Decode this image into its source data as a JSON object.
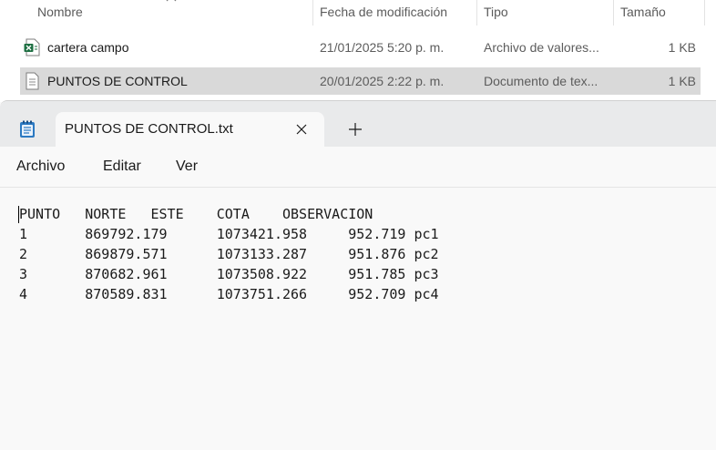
{
  "explorer": {
    "columns": {
      "name": "Nombre",
      "date": "Fecha de modificación",
      "type": "Tipo",
      "size": "Tamaño"
    },
    "files": [
      {
        "name": "cartera campo",
        "date": "21/01/2025 5:20 p. m.",
        "type": "Archivo de valores...",
        "size": "1 KB",
        "icon": "excel-csv-icon"
      },
      {
        "name": "PUNTOS DE CONTROL",
        "date": "20/01/2025 2:22 p. m.",
        "type": "Documento de tex...",
        "size": "1 KB",
        "icon": "text-document-icon",
        "selected": true
      }
    ]
  },
  "notepad": {
    "tab_title": "PUNTOS DE CONTROL.txt",
    "menu": {
      "file": "Archivo",
      "edit": "Editar",
      "view": "Ver"
    },
    "content": "PUNTO\tNORTE\tESTE\tCOTA\tOBSERVACION\n1\t869792.179\t1073421.958\t952.719 pc1\n2\t869879.571\t1073133.287\t951.876 pc2\n3\t870682.961\t1073508.922\t951.785 pc3\n4\t870589.831\t1073751.266\t952.709 pc4"
  },
  "colors": {
    "selection": "#d9d9d9",
    "tabstrip": "#e9eaeb",
    "editor_bg": "#f9f9f9",
    "excel_green": "#1d6f42",
    "notepad_blue": "#2b79c2"
  }
}
